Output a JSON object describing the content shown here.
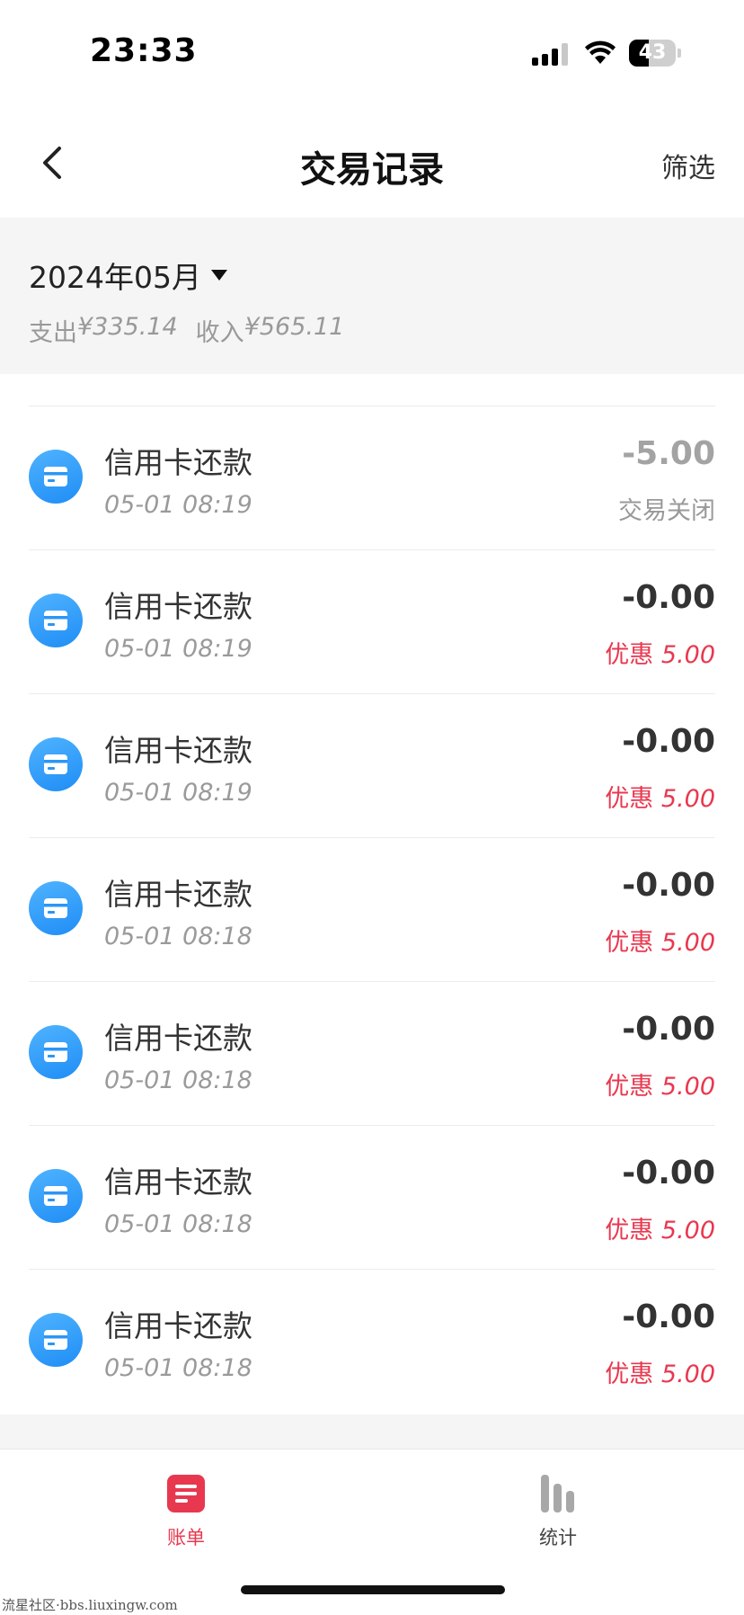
{
  "status_bar": {
    "time": "23:33",
    "battery": "43",
    "battery_level": 0.43
  },
  "nav": {
    "title": "交易记录",
    "filter_label": "筛选"
  },
  "summary": {
    "month": "2024年05月",
    "expense_label": "支出",
    "expense_amount": "¥335.14",
    "income_label": "收入",
    "income_amount": "¥565.11"
  },
  "transactions": [
    {
      "name": "信用卡还款",
      "time": "05-01 08:19",
      "amount": "-5.00",
      "status": "交易关闭",
      "status_type": "closed"
    },
    {
      "name": "信用卡还款",
      "time": "05-01 08:19",
      "amount": "-0.00",
      "discount_label": "优惠",
      "discount_amount": "5.00",
      "status_type": "discount"
    },
    {
      "name": "信用卡还款",
      "time": "05-01 08:19",
      "amount": "-0.00",
      "discount_label": "优惠",
      "discount_amount": "5.00",
      "status_type": "discount"
    },
    {
      "name": "信用卡还款",
      "time": "05-01 08:18",
      "amount": "-0.00",
      "discount_label": "优惠",
      "discount_amount": "5.00",
      "status_type": "discount"
    },
    {
      "name": "信用卡还款",
      "time": "05-01 08:18",
      "amount": "-0.00",
      "discount_label": "优惠",
      "discount_amount": "5.00",
      "status_type": "discount"
    },
    {
      "name": "信用卡还款",
      "time": "05-01 08:18",
      "amount": "-0.00",
      "discount_label": "优惠",
      "discount_amount": "5.00",
      "status_type": "discount"
    },
    {
      "name": "信用卡还款",
      "time": "05-01 08:18",
      "amount": "-0.00",
      "discount_label": "优惠",
      "discount_amount": "5.00",
      "status_type": "discount"
    }
  ],
  "tabs": {
    "bill": "账单",
    "stats": "统计",
    "active": "bill"
  },
  "watermark": "流星社区·bbs.liuxingw.com",
  "colors": {
    "accent": "#e8384f",
    "icon_blue": "#2a96f7",
    "summary_bg": "#f5f5f5"
  },
  "icons": {
    "back": "chevron-left-icon",
    "month_dropdown": "caret-down-icon",
    "transaction": "credit-card-icon",
    "bill_tab": "bill-icon",
    "stats_tab": "bar-chart-icon"
  }
}
